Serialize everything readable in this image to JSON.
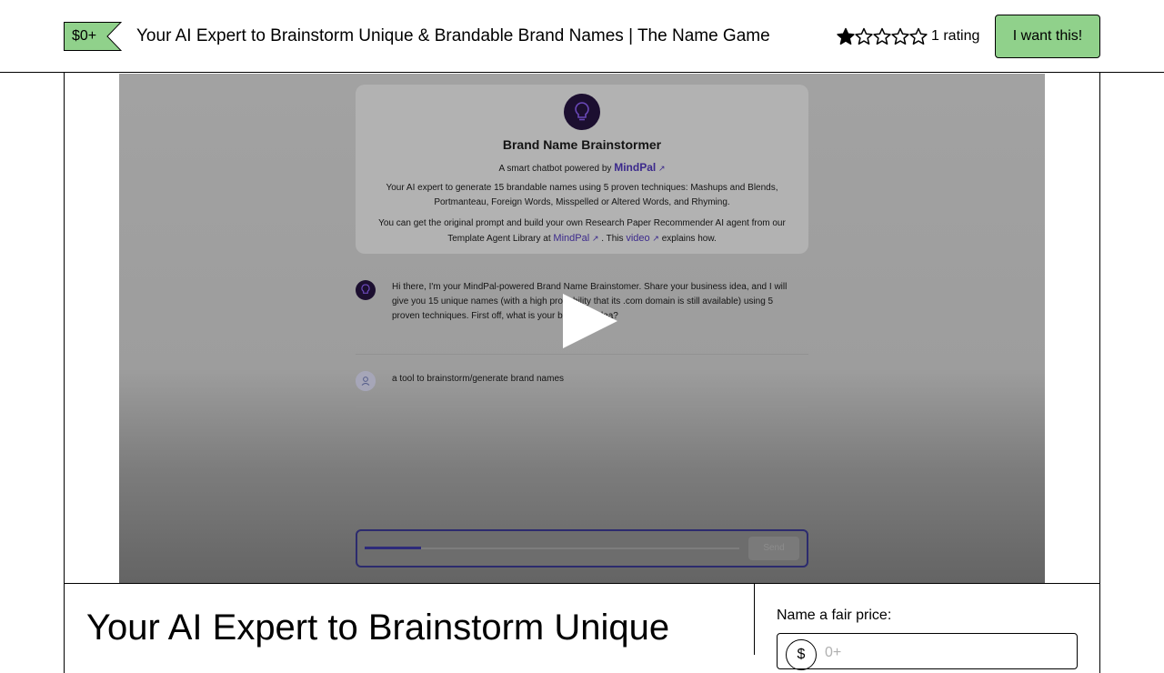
{
  "header": {
    "price_badge": "$0+",
    "product_title": "Your AI Expert to Brainstorm Unique & Brandable Brand Names | The Name Game",
    "rating_value": 1,
    "rating_max": 5,
    "rating_count": "1 rating",
    "cta_label": "I want this!",
    "cta_color": "#90d18b",
    "badge_color": "#90d18b"
  },
  "video": {
    "bot_name": "Brand Name Brainstormer",
    "powered_by_prefix": "A smart chatbot powered by",
    "powered_by_link": "MindPal",
    "description": "Your AI expert to generate 15 brandable names using 5 proven techniques: Mashups and Blends, Portmanteau, Foreign Words, Misspelled or Altered Words, and Rhyming.",
    "more_text_1": "You can get the original prompt and build your own Research Paper Recommender AI agent from our Template Agent Library at",
    "more_link_1": "MindPal",
    "more_text_2": ". This",
    "more_link_2": "video",
    "more_text_3": "explains how.",
    "bot_message": "Hi there, I'm your MindPal-powered Brand Name Brainstomer. Share your business idea, and I will give you 15 unique names (with a high probability that its .com domain is still available) using 5 proven techniques. First off, what is your business idea?",
    "user_message": "a tool to brainstorm/generate brand names",
    "send_label": "Send",
    "progress": 0.15,
    "play_icon": "play-icon"
  },
  "main": {
    "title": "Your AI Expert to Brainstorm Unique"
  },
  "sidebar": {
    "fair_price_label": "Name a fair price:",
    "currency_symbol": "$",
    "price_placeholder": "0+"
  }
}
